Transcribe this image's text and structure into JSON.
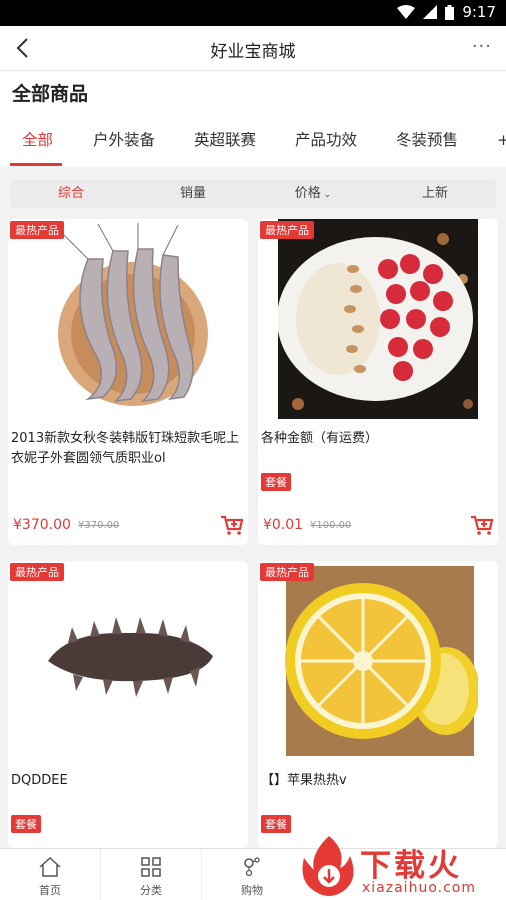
{
  "status": {
    "time": "9:17"
  },
  "nav": {
    "title": "好业宝商城",
    "more_label": "···"
  },
  "section": {
    "title": "全部商品"
  },
  "tabs": [
    {
      "label": "全部",
      "active": true
    },
    {
      "label": "户外装备"
    },
    {
      "label": "英超联赛"
    },
    {
      "label": "产品功效"
    },
    {
      "label": "冬装预售"
    },
    {
      "label": "+"
    }
  ],
  "sort": [
    {
      "label": "综合",
      "active": true
    },
    {
      "label": "销量"
    },
    {
      "label": "价格"
    },
    {
      "label": "上新"
    }
  ],
  "products": [
    {
      "badge": "最热产品",
      "name": "2013新款女秋冬装韩版钉珠短款毛呢上衣妮子外套圆领气质职业ol",
      "tag": "",
      "price": "¥370.00",
      "old_price": "¥370.00",
      "image": "shrimp"
    },
    {
      "badge": "最热产品",
      "name": "各种金额（有运费）",
      "tag": "套餐",
      "price": "¥0.01",
      "old_price": "¥100.00",
      "image": "fruit-bowl"
    },
    {
      "badge": "最热产品",
      "name": "DQDDEE",
      "tag": "套餐",
      "price": "",
      "old_price": "",
      "image": "sea-cucumber"
    },
    {
      "badge": "最热产品",
      "name": "【】苹果热热v",
      "tag": "套餐",
      "price": "",
      "old_price": "",
      "image": "grapefruit"
    }
  ],
  "bottom_nav": [
    {
      "label": "首页",
      "icon": "home-icon"
    },
    {
      "label": "分类",
      "icon": "grid-icon"
    },
    {
      "label": "购物",
      "icon": "cart-icon"
    }
  ],
  "watermark": {
    "text": "下载火",
    "sub": "xiazaihuo.com"
  },
  "colors": {
    "accent": "#e53935"
  }
}
